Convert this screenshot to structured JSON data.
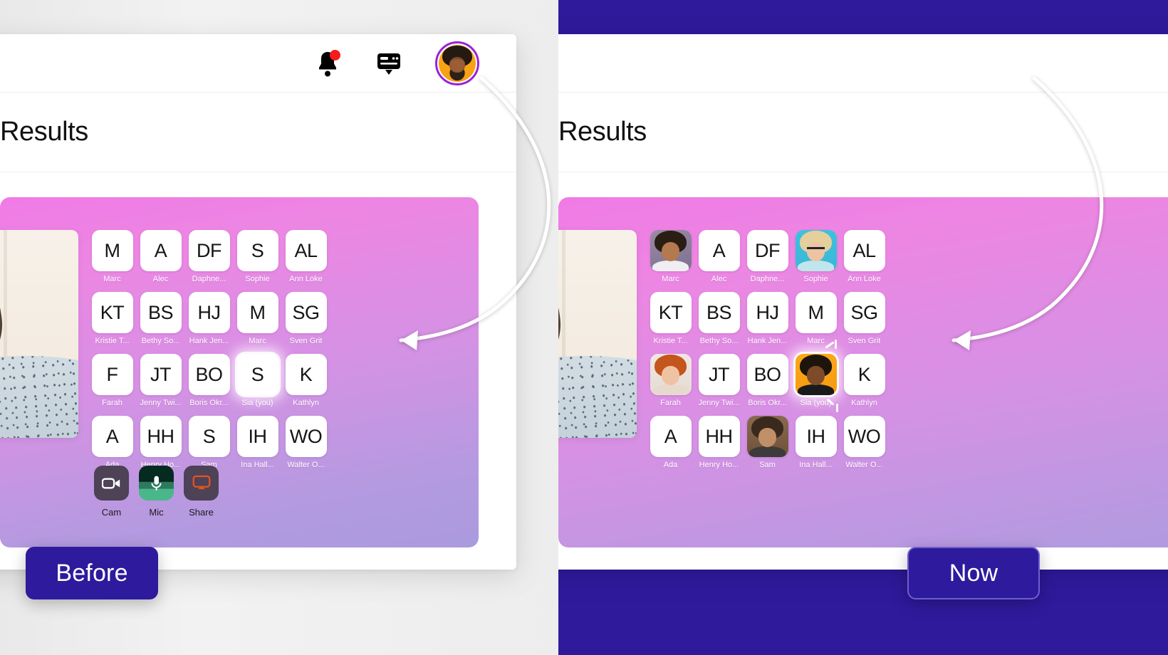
{
  "accent": {
    "indigo": "#2e1a9c",
    "pink": "#f07ae6",
    "purple": "#ab9ade",
    "badge_red": "#f61c1c",
    "ring_purple": "#9b22d6"
  },
  "panels": {
    "before": {
      "chip_label": "Before",
      "background": "#efefef"
    },
    "now": {
      "chip_label": "Now",
      "background": "#2f1a9c"
    }
  },
  "app": {
    "page_title": "Results",
    "topbar": {
      "notifications_icon": "bell-icon",
      "notifications_badge": "",
      "cards_icon": "card-menu-icon",
      "avatar_icon": "user-avatar"
    },
    "controls": [
      {
        "icon": "camera-icon",
        "label": "Cam"
      },
      {
        "icon": "microphone-icon",
        "label": "Mic"
      },
      {
        "icon": "screen-share-icon",
        "label": "Share"
      }
    ]
  },
  "participants_before": [
    {
      "initials": "M",
      "name": "Marc",
      "photo": null
    },
    {
      "initials": "A",
      "name": "Alec",
      "photo": null
    },
    {
      "initials": "DF",
      "name": "Daphne...",
      "photo": null
    },
    {
      "initials": "S",
      "name": "Sophie",
      "photo": null
    },
    {
      "initials": "AL",
      "name": "Ann Loke",
      "photo": null
    },
    {
      "initials": "KT",
      "name": "Kristie T...",
      "photo": null
    },
    {
      "initials": "BS",
      "name": "Bethy So...",
      "photo": null
    },
    {
      "initials": "HJ",
      "name": "Hank Jen...",
      "photo": null
    },
    {
      "initials": "M",
      "name": "Marc",
      "photo": null
    },
    {
      "initials": "SG",
      "name": "Sven Grit",
      "photo": null
    },
    {
      "initials": "F",
      "name": "Farah",
      "photo": null
    },
    {
      "initials": "JT",
      "name": "Jenny Twi...",
      "photo": null
    },
    {
      "initials": "BO",
      "name": "Boris Okr...",
      "photo": null
    },
    {
      "initials": "S",
      "name": "Sia (you)",
      "photo": null,
      "you": true
    },
    {
      "initials": "K",
      "name": "Kathlyn",
      "photo": null
    },
    {
      "initials": "A",
      "name": "Ada",
      "photo": null
    },
    {
      "initials": "HH",
      "name": "Henry Ho...",
      "photo": null
    },
    {
      "initials": "S",
      "name": "Sam",
      "photo": null
    },
    {
      "initials": "IH",
      "name": "Ina Hall...",
      "photo": null
    },
    {
      "initials": "WO",
      "name": "Walter O...",
      "photo": null
    }
  ],
  "participants_now": [
    {
      "initials": "M",
      "name": "Marc",
      "photo": "marc"
    },
    {
      "initials": "A",
      "name": "Alec",
      "photo": null
    },
    {
      "initials": "DF",
      "name": "Daphne...",
      "photo": null
    },
    {
      "initials": "S",
      "name": "Sophie",
      "photo": "sophie"
    },
    {
      "initials": "AL",
      "name": "Ann Loke",
      "photo": null
    },
    {
      "initials": "KT",
      "name": "Kristie T...",
      "photo": null
    },
    {
      "initials": "BS",
      "name": "Bethy So...",
      "photo": null
    },
    {
      "initials": "HJ",
      "name": "Hank Jen...",
      "photo": null
    },
    {
      "initials": "M",
      "name": "Marc",
      "photo": null
    },
    {
      "initials": "SG",
      "name": "Sven Grit",
      "photo": null
    },
    {
      "initials": "F",
      "name": "Farah",
      "photo": "farah"
    },
    {
      "initials": "JT",
      "name": "Jenny Twi...",
      "photo": null
    },
    {
      "initials": "BO",
      "name": "Boris Okr...",
      "photo": null
    },
    {
      "initials": "S",
      "name": "Sia (you)",
      "photo": "sia",
      "you": true
    },
    {
      "initials": "K",
      "name": "Kathlyn",
      "photo": null
    },
    {
      "initials": "A",
      "name": "Ada",
      "photo": null
    },
    {
      "initials": "HH",
      "name": "Henry Ho...",
      "photo": null
    },
    {
      "initials": "S",
      "name": "Sam",
      "photo": "sam"
    },
    {
      "initials": "IH",
      "name": "Ina Hall...",
      "photo": null
    },
    {
      "initials": "WO",
      "name": "Walter O...",
      "photo": null
    }
  ]
}
